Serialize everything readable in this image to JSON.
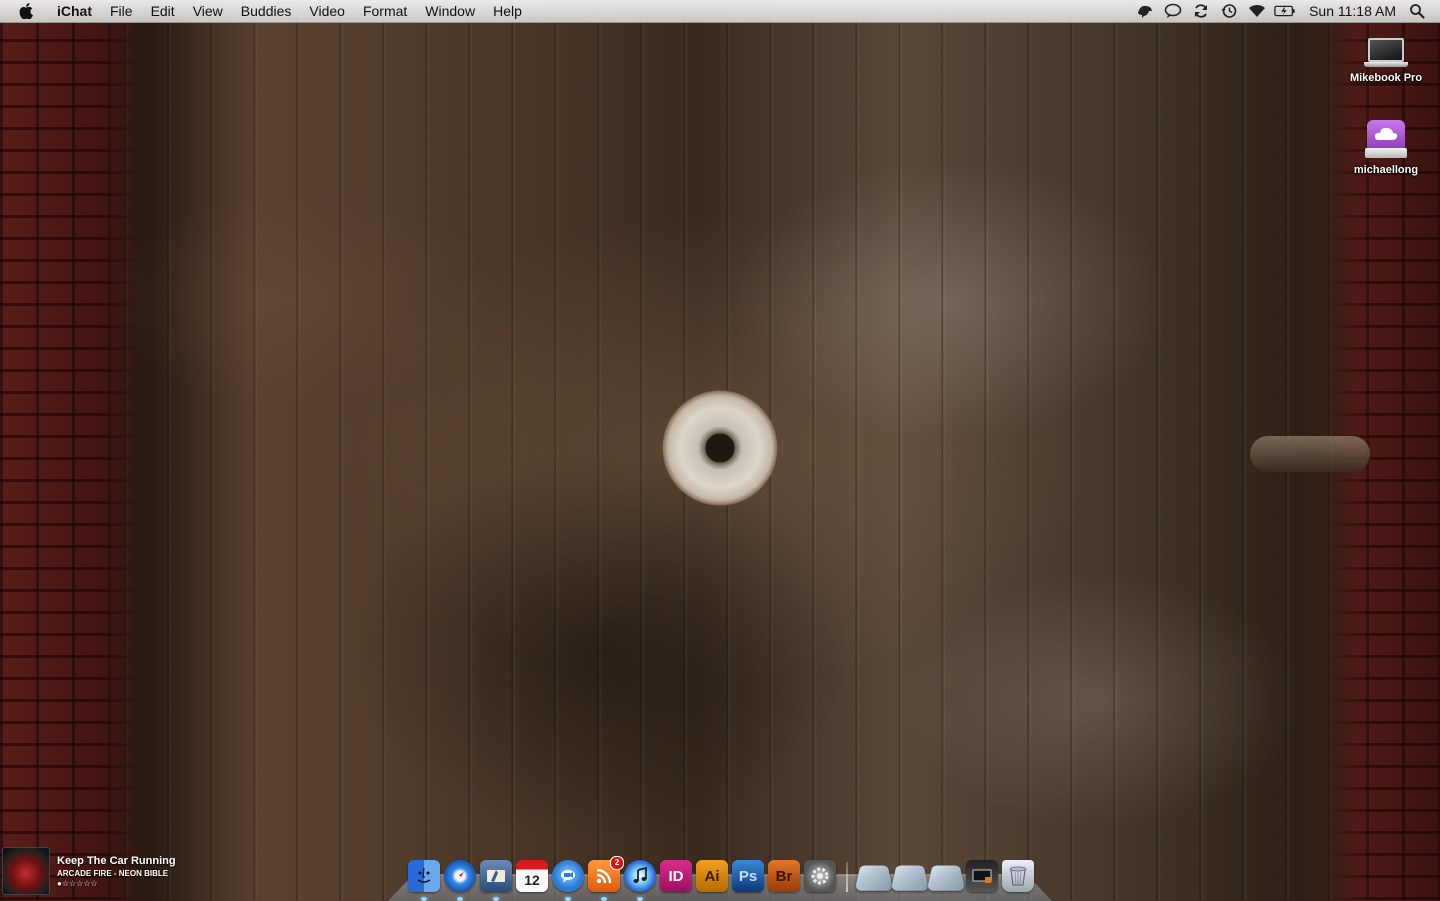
{
  "menubar": {
    "app_name": "iChat",
    "menus": [
      "File",
      "Edit",
      "View",
      "Buddies",
      "Video",
      "Format",
      "Window",
      "Help"
    ],
    "clock": "Sun 11:18 AM",
    "status_icons": [
      "growl-icon",
      "chat-bubble-icon",
      "sync-icon",
      "time-machine-icon",
      "wifi-icon",
      "battery-icon"
    ]
  },
  "desktop": {
    "icons": [
      {
        "label": "Mikebook Pro",
        "icon": "laptop-icon"
      },
      {
        "label": "michaellong",
        "icon": "idisk-icon"
      }
    ]
  },
  "now_playing": {
    "title": "Keep The Car Running",
    "artist_album": "ARCADE FIRE - NEON BIBLE",
    "rating": "●☆☆☆☆☆"
  },
  "dock": {
    "apps": [
      {
        "name": "finder-icon"
      },
      {
        "name": "safari-icon"
      },
      {
        "name": "mail-icon"
      },
      {
        "name": "ical-icon",
        "label": "12"
      },
      {
        "name": "ichat-icon"
      },
      {
        "name": "rss-reader-icon",
        "badge": "2"
      },
      {
        "name": "itunes-icon"
      },
      {
        "name": "indesign-icon",
        "label": "ID"
      },
      {
        "name": "illustrator-icon",
        "label": "Ai"
      },
      {
        "name": "photoshop-icon",
        "label": "Ps"
      },
      {
        "name": "bridge-icon",
        "label": "Br"
      },
      {
        "name": "system-preferences-icon"
      }
    ]
  }
}
